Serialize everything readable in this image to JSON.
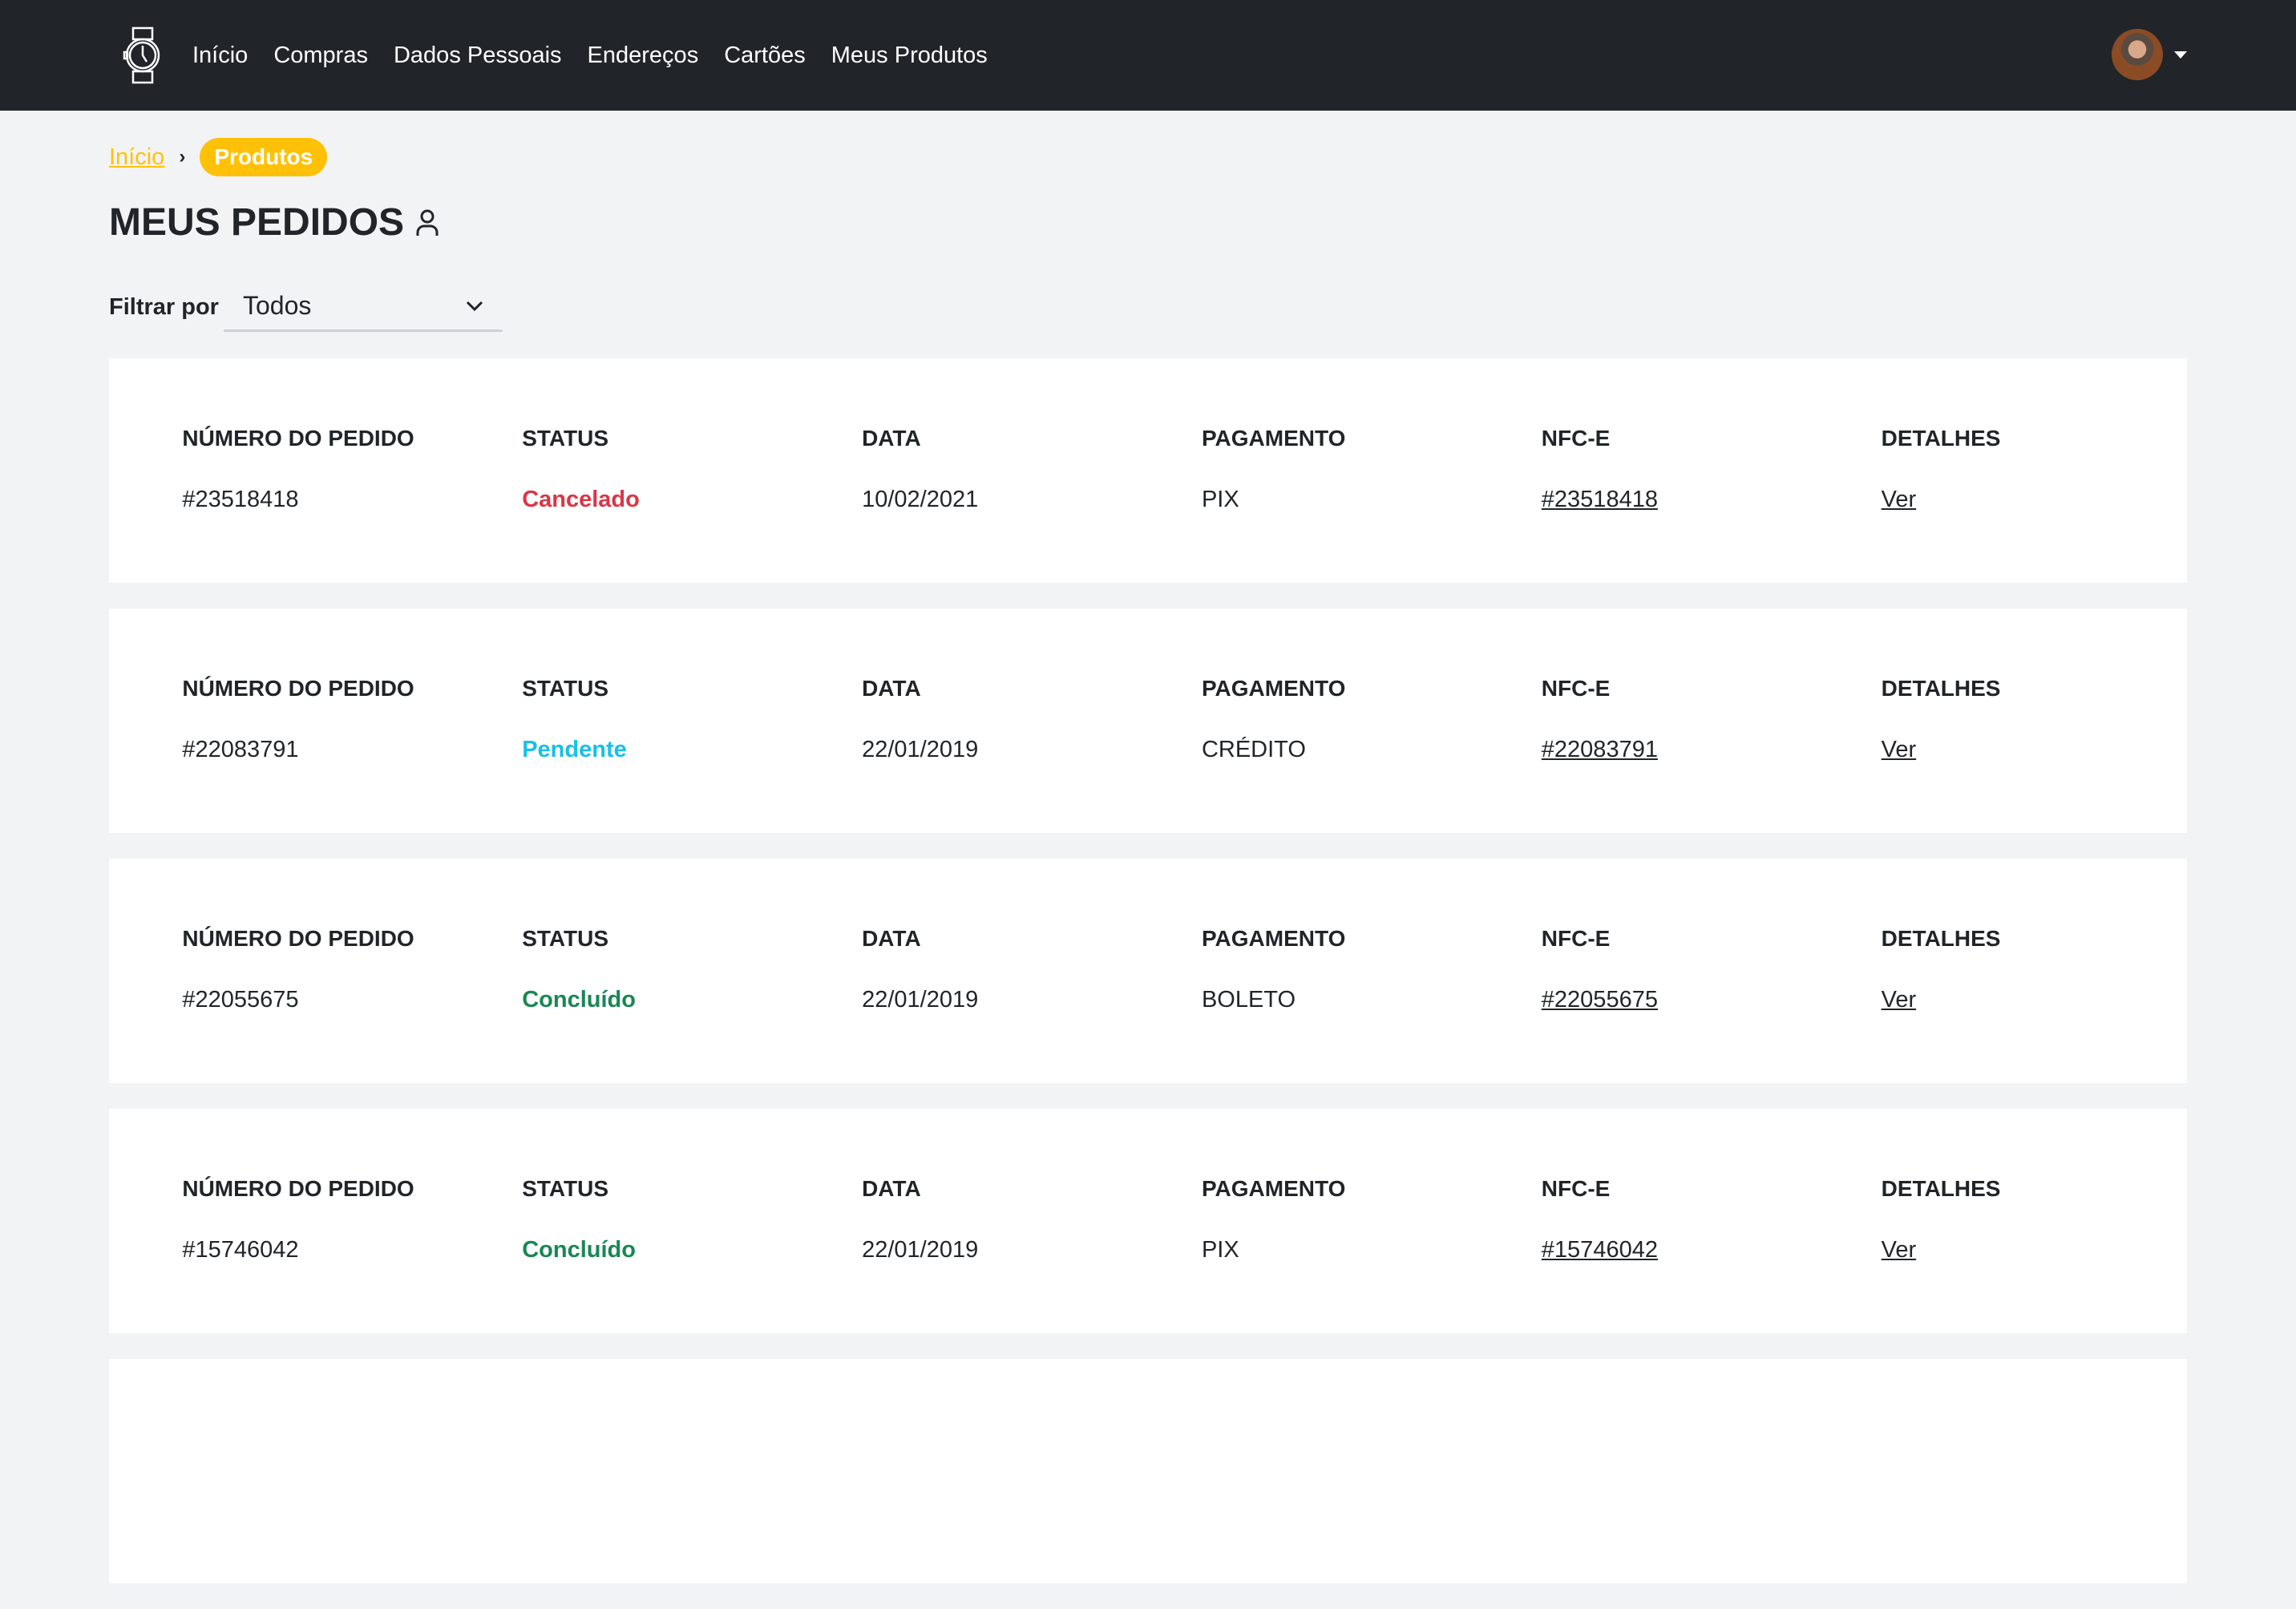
{
  "nav": {
    "links": [
      "Início",
      "Compras",
      "Dados Pessoais",
      "Endereços",
      "Cartões",
      "Meus Produtos"
    ]
  },
  "breadcrumb": {
    "home": "Início",
    "current": "Produtos"
  },
  "title": "MEUS PEDIDOS",
  "filter": {
    "label": "Filtrar por",
    "value": "Todos"
  },
  "headers": {
    "number": "NÚMERO DO PEDIDO",
    "status": "STATUS",
    "date": "DATA",
    "payment": "PAGAMENTO",
    "nfce": "NFC-E",
    "details": "DETALHES"
  },
  "colors": {
    "accent": "#ffc107",
    "cancelado": "#dc3545",
    "pendente": "#17c1e8",
    "concluido": "#198754"
  },
  "orders": [
    {
      "number": "#23518418",
      "status": "Cancelado",
      "status_key": "cancelado",
      "date": "10/02/2021",
      "payment": "PIX",
      "nfce": "#23518418",
      "details": "Ver"
    },
    {
      "number": "#22083791",
      "status": "Pendente",
      "status_key": "pendente",
      "date": "22/01/2019",
      "payment": "CRÉDITO",
      "nfce": "#22083791",
      "details": "Ver"
    },
    {
      "number": "#22055675",
      "status": "Concluído",
      "status_key": "concluido",
      "date": "22/01/2019",
      "payment": "BOLETO",
      "nfce": "#22055675",
      "details": "Ver"
    },
    {
      "number": "#15746042",
      "status": "Concluído",
      "status_key": "concluido",
      "date": "22/01/2019",
      "payment": "PIX",
      "nfce": "#15746042",
      "details": "Ver"
    }
  ]
}
